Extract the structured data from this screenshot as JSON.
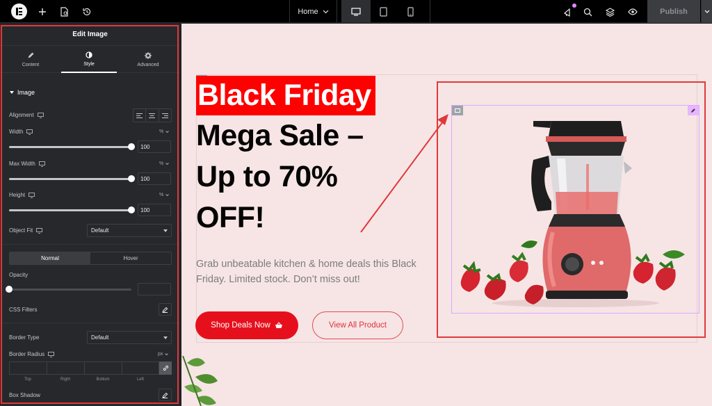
{
  "topbar": {
    "page_name": "Home",
    "publish_label": "Publish"
  },
  "panel": {
    "title": "Edit Image",
    "tabs": [
      {
        "label": "Content",
        "icon": "pencil-icon"
      },
      {
        "label": "Style",
        "icon": "half-circle-icon"
      },
      {
        "label": "Advanced",
        "icon": "gear-icon"
      }
    ],
    "section_title": "Image",
    "alignment_label": "Alignment",
    "width": {
      "label": "Width",
      "unit": "%",
      "value": "100",
      "level": 1.0
    },
    "max_width": {
      "label": "Max Width",
      "unit": "%",
      "value": "100",
      "level": 1.0
    },
    "height": {
      "label": "Height",
      "unit": "%",
      "value": "100",
      "level": 1.0
    },
    "object_fit": {
      "label": "Object Fit",
      "value": "Default"
    },
    "state_tabs": [
      "Normal",
      "Hover"
    ],
    "opacity": {
      "label": "Opacity",
      "value": "",
      "level": 0.0
    },
    "css_filters_label": "CSS Filters",
    "border_type": {
      "label": "Border Type",
      "value": "Default"
    },
    "border_radius": {
      "label": "Border Radius",
      "unit": "px",
      "sides": [
        "Top",
        "Right",
        "Bottom",
        "Left"
      ]
    },
    "box_shadow_label": "Box Shadow"
  },
  "canvas": {
    "headline_highlight": "Black Friday",
    "headline_lines": [
      "Mega Sale –",
      "Up to 70%",
      "OFF!"
    ],
    "description": "Grab unbeatable kitchen & home deals this Black Friday. Limited stock. Don’t miss out!",
    "primary_button": "Shop Deals Now",
    "secondary_button": "View All Product",
    "colors": {
      "accent": "#e6101d",
      "background": "#f7e5e5",
      "highlight_frame": "#e0383b"
    }
  }
}
